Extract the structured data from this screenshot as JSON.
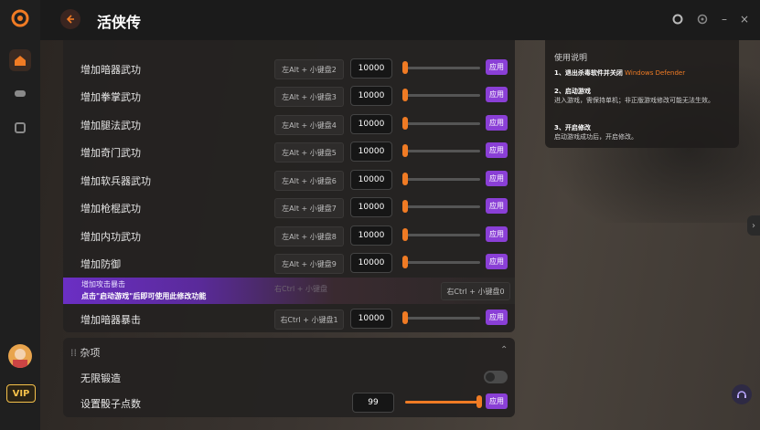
{
  "app": {
    "title": "活侠传",
    "vip_label": "VIP"
  },
  "rows": [
    {
      "name": "增加暗器武功",
      "hotkey": "左Alt + 小键盘2",
      "value": "10000",
      "apply": "应用"
    },
    {
      "name": "增加拳掌武功",
      "hotkey": "左Alt + 小键盘3",
      "value": "10000",
      "apply": "应用"
    },
    {
      "name": "增加腿法武功",
      "hotkey": "左Alt + 小键盘4",
      "value": "10000",
      "apply": "应用"
    },
    {
      "name": "增加奇门武功",
      "hotkey": "左Alt + 小键盘5",
      "value": "10000",
      "apply": "应用"
    },
    {
      "name": "增加软兵器武功",
      "hotkey": "左Alt + 小键盘6",
      "value": "10000",
      "apply": "应用"
    },
    {
      "name": "增加枪棍武功",
      "hotkey": "左Alt + 小键盘7",
      "value": "10000",
      "apply": "应用"
    },
    {
      "name": "增加内功武功",
      "hotkey": "左Alt + 小键盘8",
      "value": "10000",
      "apply": "应用"
    },
    {
      "name": "增加防御",
      "hotkey": "左Alt + 小键盘9",
      "value": "10000",
      "apply": "应用"
    }
  ],
  "banner": {
    "title": "增加攻击暴击",
    "notice": "点击\"启动游戏\"后即可使用此修改功能",
    "ghost_hotkey": "右Ctrl + 小键盘",
    "hotkey": "右Ctrl + 小键盘0"
  },
  "last_row": {
    "name": "增加暗器暴击",
    "hotkey": "右Ctrl + 小键盘1",
    "value": "10000",
    "apply": "应用"
  },
  "misc": {
    "header": "杂项",
    "toggle_label": "无限锻造",
    "toggle_on": false,
    "dice_label": "设置骰子点数",
    "dice_value": "99",
    "dice_apply": "应用",
    "dice_fill": 1.0
  },
  "info": {
    "title": "使用说明",
    "step1_title": "1、退出杀毒软件并关闭",
    "step1_highlight": "Windows Defender",
    "step2_title": "2、启动游戏",
    "step2_text": "进入游戏，需保持单机；非正版游戏修改可能无法生效。",
    "step3_title": "3、开启修改",
    "step3_text": "启动游戏成功后，开启修改。"
  },
  "colors": {
    "accent": "#f07b24",
    "apply": "#8a3fd6",
    "vip": "#f5c14a"
  }
}
